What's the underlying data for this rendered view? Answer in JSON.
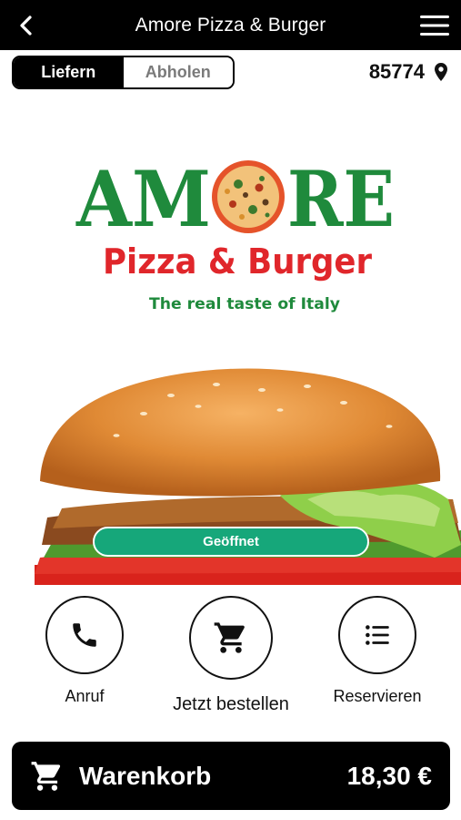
{
  "header": {
    "title": "Amore Pizza & Burger",
    "back_icon": "chevron-left-icon",
    "menu_icon": "hamburger-menu-icon"
  },
  "mode": {
    "delivery_label": "Liefern",
    "pickup_label": "Abholen",
    "selected": "Liefern"
  },
  "location": {
    "postcode": "85774",
    "icon": "map-pin-icon"
  },
  "logo": {
    "wordmark": "AMORE",
    "subtitle": "Pizza & Burger",
    "tagline": "The real taste of Italy",
    "green": "#1f8a3c",
    "red": "#e0262b"
  },
  "status": {
    "label": "Geöffnet",
    "color": "#16a77a"
  },
  "actions": {
    "call_label": "Anruf",
    "order_label": "Jetzt bestellen",
    "reserve_label": "Reservieren"
  },
  "cart": {
    "label": "Warenkorb",
    "total": "18,30 €",
    "icon": "shopping-cart-icon"
  }
}
